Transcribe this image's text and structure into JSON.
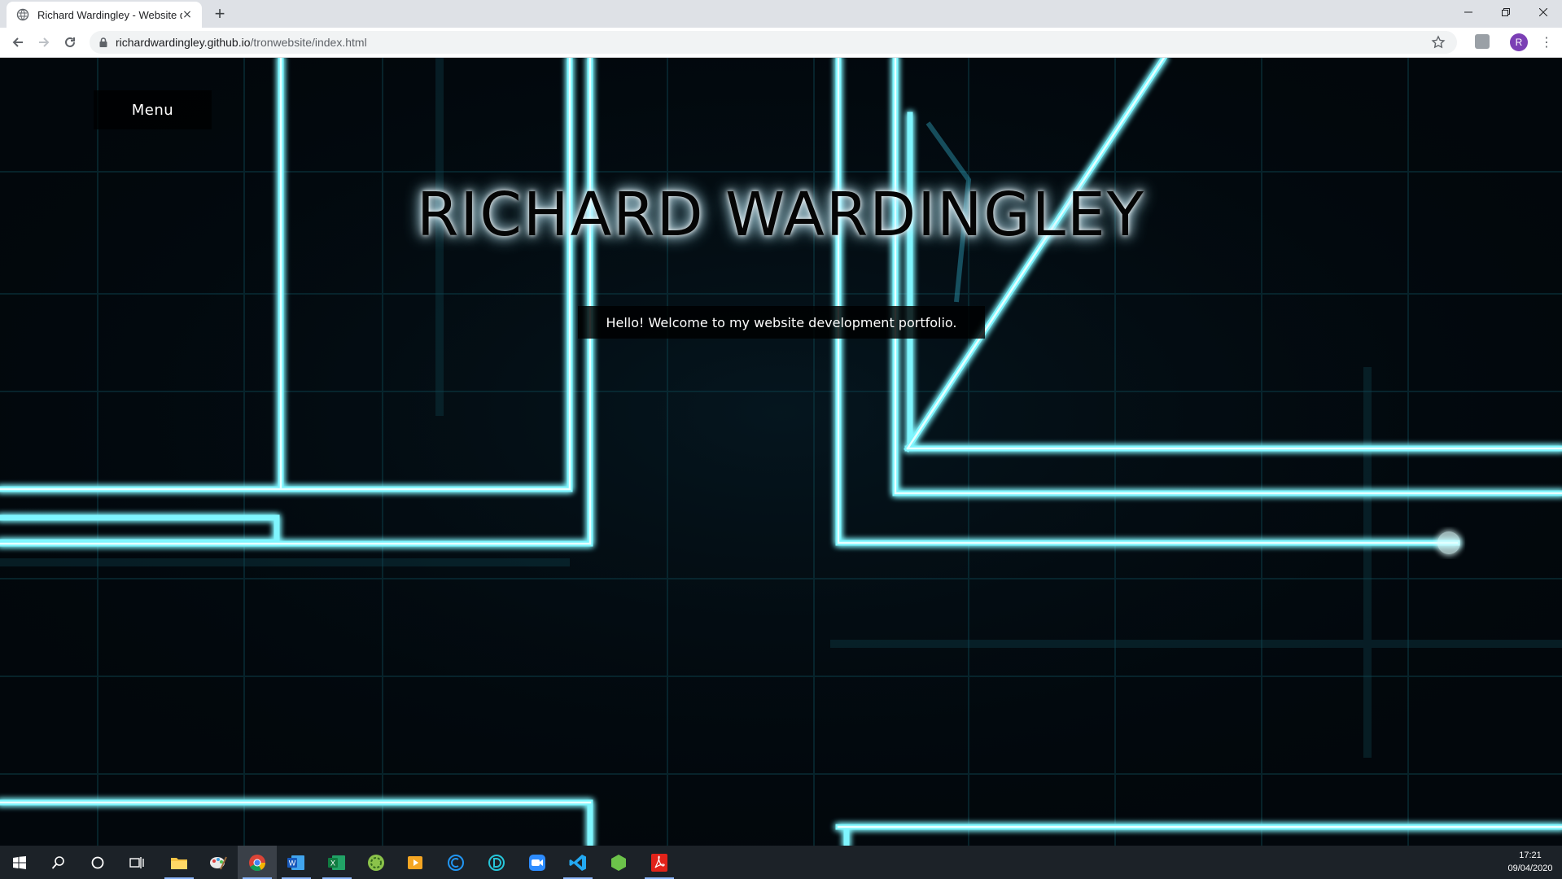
{
  "browser": {
    "tab_title": "Richard Wardingley - Website de",
    "tab_close_glyph": "×",
    "new_tab_glyph": "+",
    "url_host": "richardwardingley.github.io",
    "url_path": "/tronwebsite/index.html",
    "profile_initial": "R"
  },
  "page": {
    "menu_label": "Menu",
    "title": "RICHARD WARDINGLEY",
    "welcome": "Hello! Welcome to my website development portfolio."
  },
  "taskbar": {
    "time": "17:21",
    "date": "09/04/2020",
    "pinned_icons": [
      "windows-start-icon",
      "search-icon",
      "cortana-icon",
      "task-view-icon",
      "file-explorer-icon",
      "paint-icon",
      "chrome-icon",
      "word-icon",
      "excel-icon",
      "green-app-icon",
      "media-player-icon",
      "ccleaner-icon",
      "d-app-icon",
      "zoom-icon",
      "vscode-icon",
      "node-icon",
      "acrobat-icon"
    ]
  },
  "colors": {
    "neon": "#5ff2ff",
    "neon_glow": "#1fb8d8",
    "background": "#02070c",
    "taskbar": "#1c2228"
  }
}
